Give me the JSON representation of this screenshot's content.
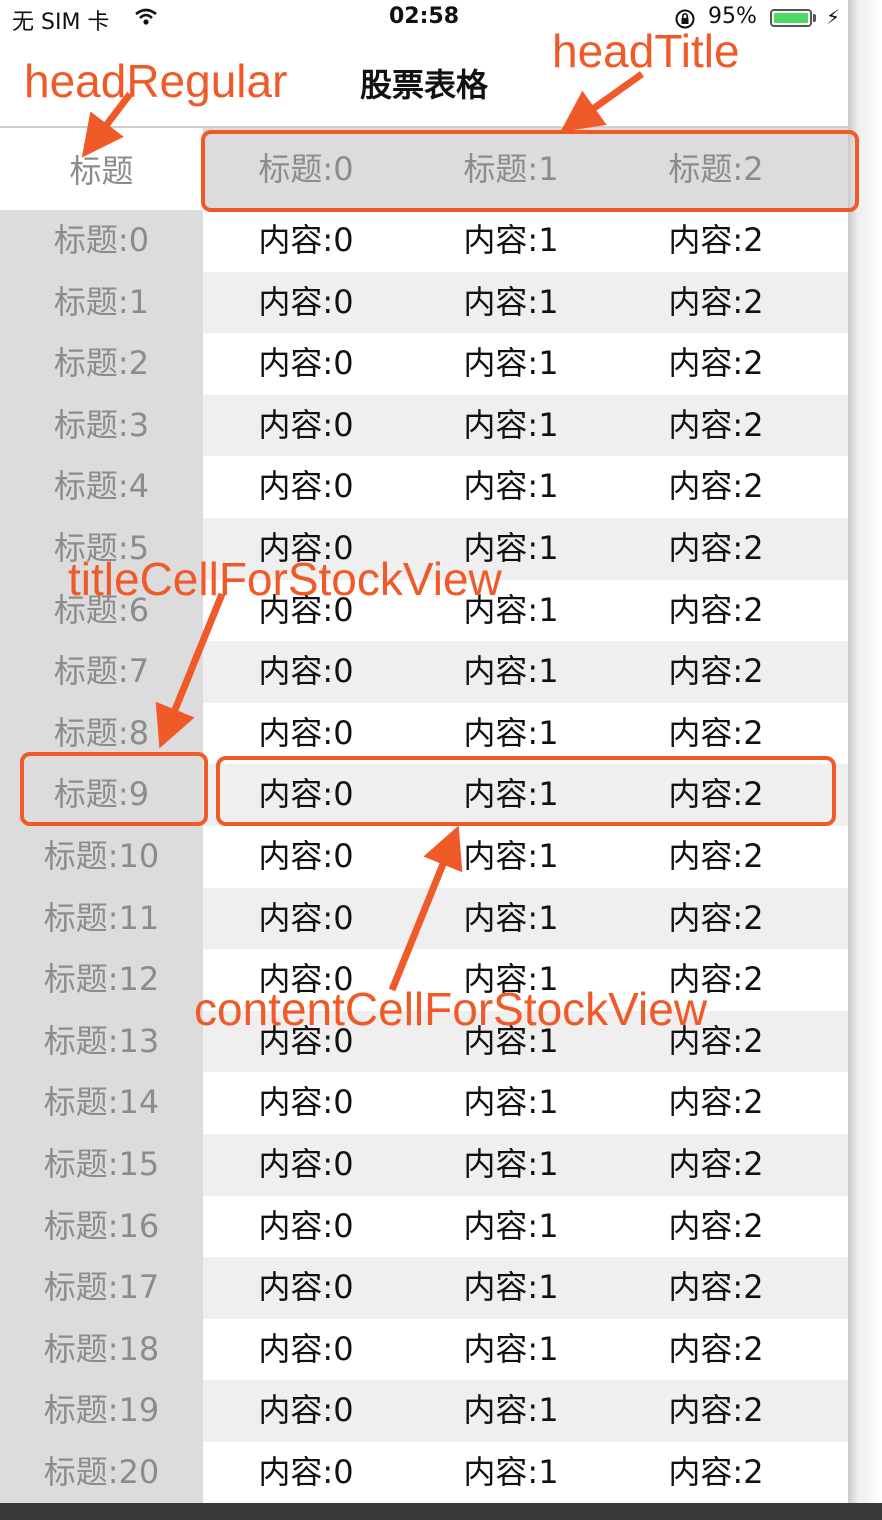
{
  "status_bar": {
    "carrier": "无 SIM 卡",
    "time": "02:58",
    "battery": "95%",
    "battery_level": 0.95,
    "icons": [
      "wifi-icon",
      "rotation-lock-icon",
      "battery-icon",
      "charging-bolt-icon"
    ]
  },
  "nav": {
    "title": "股票表格"
  },
  "table": {
    "head_regular": "标题",
    "head_titles": [
      "标题:0",
      "标题:1",
      "标题:2"
    ],
    "row_titles": [
      "标题:0",
      "标题:1",
      "标题:2",
      "标题:3",
      "标题:4",
      "标题:5",
      "标题:6",
      "标题:7",
      "标题:8",
      "标题:9",
      "标题:10",
      "标题:11",
      "标题:12",
      "标题:13",
      "标题:14",
      "标题:15",
      "标题:16",
      "标题:17",
      "标题:18",
      "标题:19",
      "标题:20"
    ],
    "row_content": [
      "内容:0",
      "内容:1",
      "内容:2"
    ]
  },
  "annotations": {
    "head_regular": "headRegular",
    "head_title": "headTitle",
    "title_cell": "titleCellForStockView",
    "content_cell": "contentCellForStockView",
    "color": "#f05a28"
  }
}
